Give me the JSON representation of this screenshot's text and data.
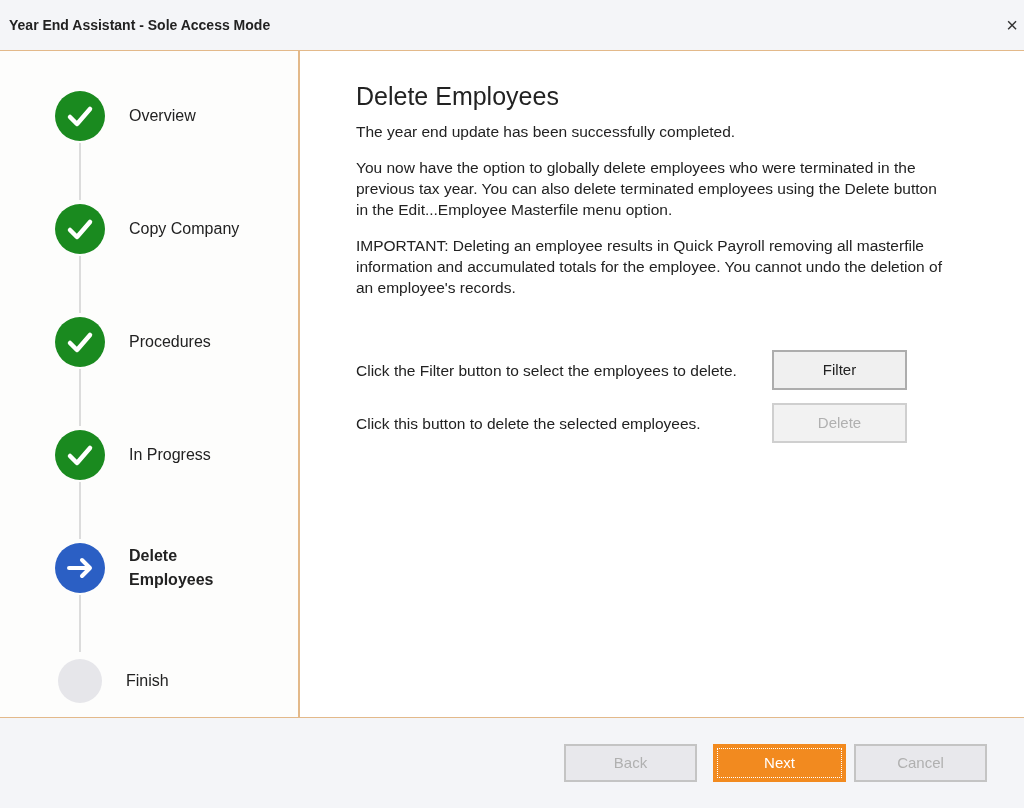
{
  "window": {
    "title": "Year End Assistant - Sole Access Mode",
    "close": "×"
  },
  "steps": [
    {
      "label": "Overview",
      "kind": "done"
    },
    {
      "label": "Copy Company",
      "kind": "done"
    },
    {
      "label": "Procedures",
      "kind": "done"
    },
    {
      "label": "In Progress",
      "kind": "done"
    },
    {
      "label": "Delete Employees",
      "kind": "current"
    },
    {
      "label": "Finish",
      "kind": "pending"
    }
  ],
  "heading": "Delete Employees",
  "paragraphs": [
    "The year end update has been successfully completed.",
    "You now have the option to globally delete employees who were terminated in the previous tax year. You can also delete terminated employees using the Delete button in the Edit...Employee Masterfile menu option.",
    "IMPORTANT: Deleting an employee results in Quick Payroll removing all masterfile information and accumulated totals for the employee. You cannot undo the deletion of an employee's records."
  ],
  "actions": [
    {
      "text": "Click the Filter button to select the employees to delete.",
      "button": {
        "label": "Filter",
        "disabled": false
      }
    },
    {
      "text": "Click this button to delete the selected employees.",
      "button": {
        "label": "Delete",
        "disabled": true
      }
    }
  ],
  "footer_buttons": [
    {
      "label": "Back",
      "kind": "default",
      "disabled": true
    },
    {
      "label": "Next",
      "kind": "primary",
      "disabled": false
    },
    {
      "label": "Cancel",
      "kind": "default",
      "disabled": true
    }
  ]
}
